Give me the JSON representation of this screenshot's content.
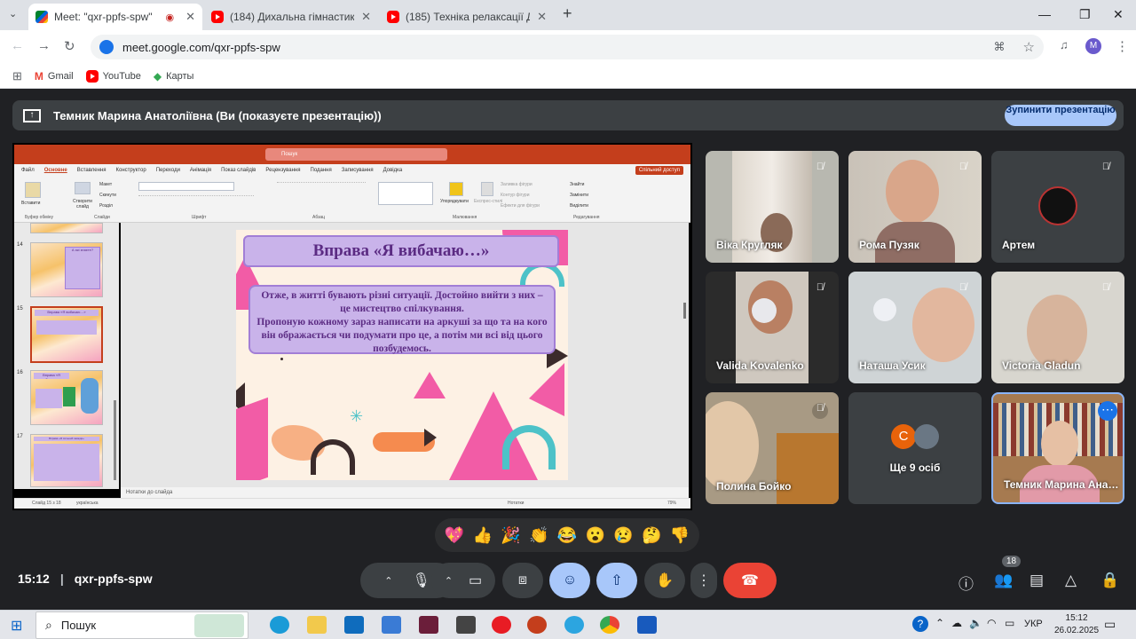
{
  "browser": {
    "tabs": [
      {
        "title": "Meet: \"qxr-ppfs-spw\"",
        "icon": "meet-favicon",
        "active": true
      },
      {
        "title": "(184) Дихальна гімнастика, ре",
        "icon": "youtube-favicon",
        "active": false
      },
      {
        "title": "(185) Техніка релаксації Джейс",
        "icon": "youtube-favicon",
        "active": false
      }
    ],
    "url": "meet.google.com/qxr-ppfs-spw",
    "profile_initial": "M",
    "bookmarks": [
      {
        "label": "Gmail",
        "icon": "gmail-icon"
      },
      {
        "label": "YouTube",
        "icon": "youtube-icon"
      },
      {
        "label": "Карты",
        "icon": "maps-icon"
      }
    ]
  },
  "meet": {
    "presenting_banner": "Темник Марина Анатоліївна (Ви (показуєте презентацію))",
    "stop_presenting_label": "Зупинити презентацію",
    "participants": [
      {
        "name": "Віка Кругляк",
        "muted": true
      },
      {
        "name": "Рома Пузяк",
        "muted": true
      },
      {
        "name": "Артем",
        "muted": true
      },
      {
        "name": "Valida Kovalenko",
        "muted": true
      },
      {
        "name": "Наташа Усик",
        "muted": true
      },
      {
        "name": "Victoria Gladun",
        "muted": true
      },
      {
        "name": "Полина Бойко",
        "muted": true
      },
      {
        "name": "Ще 9 осіб",
        "avatar_letter": "С"
      },
      {
        "name": "Темник Марина Ана…",
        "speaking": true
      }
    ],
    "reactions": [
      "💖",
      "👍",
      "🎉",
      "👏",
      "😂",
      "😮",
      "😢",
      "🤔",
      "👎"
    ],
    "time": "15:12",
    "meeting_code": "qxr-ppfs-spw",
    "people_count": "18"
  },
  "powerpoint": {
    "search_placeholder": "Пошук",
    "menu": [
      "Файл",
      "Основне",
      "Вставлення",
      "Конструктор",
      "Переходи",
      "Анімація",
      "Показ слайдів",
      "Рецензування",
      "Подання",
      "Записування",
      "Довідка"
    ],
    "share_label": "Спільний доступ",
    "ribbon_groups": [
      "Буфер обміну",
      "Слайди",
      "Шрифт",
      "Абзац",
      "Малювання",
      "Редагування"
    ],
    "ribbon_buttons": {
      "paste": "Вставити",
      "new_slide": "Створити слайд",
      "layout": "Макет",
      "reset": "Скинути",
      "section": "Розділ",
      "arrange": "Упорядкувати",
      "styles": "Експрес-стилі",
      "fill": "Заливка фігури",
      "outline": "Контур фігури",
      "effects": "Ефекти для фігури",
      "find": "Знайти",
      "replace": "Замінити",
      "select": "Виділити"
    },
    "thumbnails": [
      {
        "num": "14",
        "title": "А які знаєте?"
      },
      {
        "num": "15",
        "title": "Вправа «Я вибачаю…»",
        "selected": true
      },
      {
        "num": "16",
        "title": "Вправа «Я вибачаю…»"
      },
      {
        "num": "17",
        "title": "Вправа «Я сильний завжди»"
      }
    ],
    "slide": {
      "title": "Вправа «Я вибачаю…»",
      "body_line1": "Отже, в житті бувають різні ситуації. Достойно вийти з них – це мистецтво спілкування.",
      "body_line2": "Пропоную кожному  зараз написати на аркуші за що та на кого  він ображається чи подумати про це, а потім ми всі від цього позбудемось."
    },
    "notes_placeholder": "Нотатки до слайда",
    "status": "Слайд 15 з 18",
    "language": "українська",
    "notes_button": "Нотатки",
    "zoom": "79%"
  },
  "taskbar": {
    "search_placeholder": "Пошук",
    "language": "УКР",
    "time": "15:12",
    "date": "26.02.2025"
  }
}
